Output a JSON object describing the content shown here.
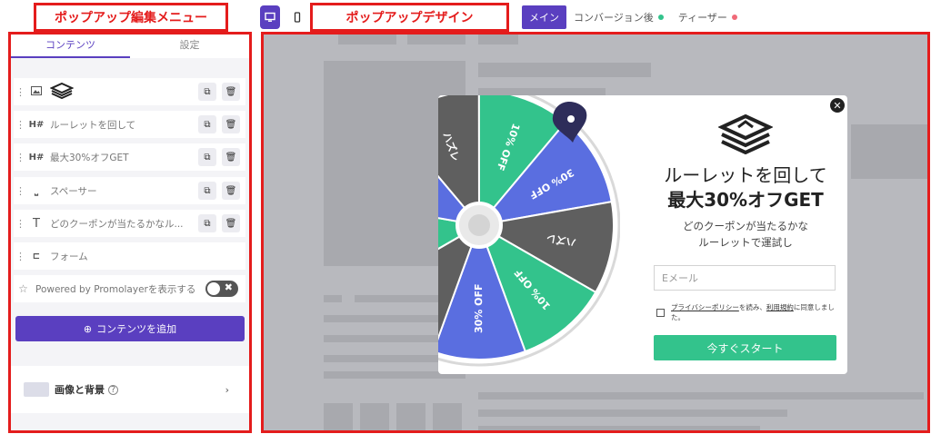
{
  "annotations": {
    "left_label": "ポップアップ編集メニュー",
    "right_label": "ポップアップデザイン"
  },
  "topbar": {
    "tabs": [
      "メイン",
      "コンバージョン後",
      "ティーザー"
    ],
    "dot_colors": [
      "#33c38c",
      "#f06a78"
    ],
    "accent": "#5a3fc0"
  },
  "left_panel": {
    "tabs": [
      "コンテンツ",
      "設定"
    ],
    "items": [
      {
        "type_icon": "image-icon",
        "label": ""
      },
      {
        "type_icon": "heading-icon",
        "label": "ルーレットを回して"
      },
      {
        "type_icon": "heading-icon",
        "label": "最大30%オフGET"
      },
      {
        "type_icon": "spacer-icon",
        "label": "スペーサー"
      },
      {
        "type_icon": "text-icon",
        "label": "どのクーポンが当たるかなル..."
      },
      {
        "type_icon": "form-icon",
        "label": "フォーム"
      }
    ],
    "heading_mark": "H#",
    "text_mark": "T",
    "powered_label": "Powered by Promolayerを表示する",
    "add_content_label": "コンテンツを追加",
    "image_bg_label": "画像と背景"
  },
  "popup": {
    "wheel_segments": [
      "ハズレ",
      "10% OFF",
      "30% OFF",
      "ハズレ",
      "10% OFF",
      "30% OFF",
      "ハズレ",
      "10% OFF",
      "30% OFF"
    ],
    "wheel_colors": [
      "#33c38c",
      "#5a6ee0",
      "#5f5f5f"
    ],
    "title_line1": "ルーレットを回して",
    "title_line2": "最大30%オフGET",
    "subtitle_line1": "どのクーポンが当たるかな",
    "subtitle_line2": "ルーレットで運試し",
    "email_placeholder": "Eメール",
    "consent_link1": "プライバシーポリシー",
    "consent_mid": "を読み、",
    "consent_link2": "利用規約",
    "consent_end": "に同意しました。",
    "start_button": "今すぐスタート",
    "start_color": "#33c38c"
  }
}
